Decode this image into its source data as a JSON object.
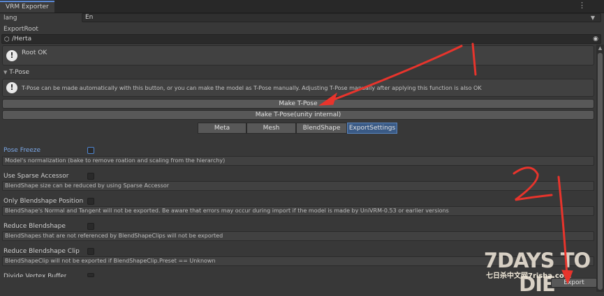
{
  "window": {
    "tab_title": "VRM Exporter",
    "menu_glyph": "⋮"
  },
  "lang": {
    "label": "lang",
    "value": "En"
  },
  "export_root": {
    "label": "ExportRoot",
    "value": "/Herta"
  },
  "root_status": {
    "message": "Root OK"
  },
  "tpose_section": {
    "title": "T-Pose",
    "help": "T-Pose can be made automatically with this button, or you can make the model as T-Pose manually. Adjusting T-Pose manually after applying this function is also OK",
    "make_tpose_label": "Make T-Pose",
    "make_tpose_internal_label": "Make T-Pose(unity internal)"
  },
  "tabs": [
    {
      "label": "Meta",
      "active": false
    },
    {
      "label": "Mesh",
      "active": false
    },
    {
      "label": "BlendShape",
      "active": false
    },
    {
      "label": "ExportSettings",
      "active": true
    }
  ],
  "options": [
    {
      "label": "Pose Freeze",
      "checked": false,
      "active": true,
      "description": "Model's normalization (bake to remove roation and scaling from the hierarchy)"
    },
    {
      "label": "Use Sparse Accessor",
      "checked": false,
      "active": false,
      "description": "BlendShape size can be reduced by using Sparse Accessor"
    },
    {
      "label": "Only Blendshape Position",
      "checked": false,
      "active": false,
      "description": "BlendShape's Normal and Tangent will not be exported. Be aware that errors may occur during import if the model is made by UniVRM-0.53 or earlier versions"
    },
    {
      "label": "Reduce Blendshape",
      "checked": false,
      "active": false,
      "description": "BlendShapes that are not referenced by BlendShapeClips will not be exported"
    },
    {
      "label": "Reduce Blendshape Clip",
      "checked": false,
      "active": false,
      "description": "BlendShapeClip will not be exported if BlendShapeClip.Preset == Unknown"
    },
    {
      "label": "Divide Vertex Buffer",
      "checked": false,
      "active": false,
      "description": ""
    }
  ],
  "export_button": {
    "label": "Export"
  },
  "watermark": {
    "title": "7DAYS TO DIE",
    "subtitle": "七日杀中文网7risha.com"
  },
  "annotations": {
    "mark_1": "1",
    "mark_2": "2",
    "arrow_color": "#e8342c"
  },
  "colors": {
    "accent": "#5a8ad8",
    "active_tab": "#3a5a85",
    "active_label": "#7ba7e6"
  }
}
